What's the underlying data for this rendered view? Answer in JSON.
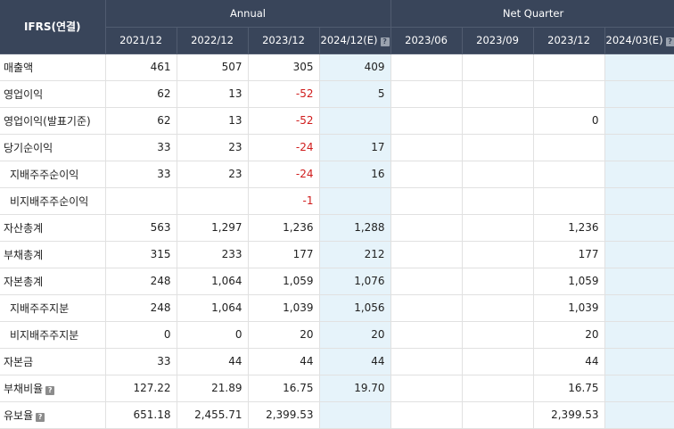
{
  "header": {
    "corner": "IFRS(연결)",
    "annual_label": "Annual",
    "quarter_label": "Net Quarter",
    "help_icon_glyph": "?",
    "annual_periods": [
      "2021/12",
      "2022/12",
      "2023/12",
      "2024/12(E)"
    ],
    "quarter_periods": [
      "2023/06",
      "2023/09",
      "2023/12",
      "2024/03(E)"
    ]
  },
  "rows": [
    {
      "label": "매출액",
      "indent": false,
      "help": false,
      "values": [
        "461",
        "507",
        "305",
        "409",
        "",
        "",
        "",
        ""
      ]
    },
    {
      "label": "영업이익",
      "indent": false,
      "help": false,
      "values": [
        "62",
        "13",
        "-52",
        "5",
        "",
        "",
        "",
        ""
      ]
    },
    {
      "label": "영업이익(발표기준)",
      "indent": false,
      "help": false,
      "values": [
        "62",
        "13",
        "-52",
        "",
        "",
        "",
        "0",
        ""
      ]
    },
    {
      "label": "당기순이익",
      "indent": false,
      "help": false,
      "values": [
        "33",
        "23",
        "-24",
        "17",
        "",
        "",
        "",
        ""
      ]
    },
    {
      "label": "지배주주순이익",
      "indent": true,
      "help": false,
      "values": [
        "33",
        "23",
        "-24",
        "16",
        "",
        "",
        "",
        ""
      ]
    },
    {
      "label": "비지배주주순이익",
      "indent": true,
      "help": false,
      "values": [
        "",
        "",
        "-1",
        "",
        "",
        "",
        "",
        ""
      ]
    },
    {
      "label": "자산총계",
      "indent": false,
      "help": false,
      "values": [
        "563",
        "1,297",
        "1,236",
        "1,288",
        "",
        "",
        "1,236",
        ""
      ]
    },
    {
      "label": "부채총계",
      "indent": false,
      "help": false,
      "values": [
        "315",
        "233",
        "177",
        "212",
        "",
        "",
        "177",
        ""
      ]
    },
    {
      "label": "자본총계",
      "indent": false,
      "help": false,
      "values": [
        "248",
        "1,064",
        "1,059",
        "1,076",
        "",
        "",
        "1,059",
        ""
      ]
    },
    {
      "label": "지배주주지분",
      "indent": true,
      "help": false,
      "values": [
        "248",
        "1,064",
        "1,039",
        "1,056",
        "",
        "",
        "1,039",
        ""
      ]
    },
    {
      "label": "비지배주주지분",
      "indent": true,
      "help": false,
      "values": [
        "0",
        "0",
        "20",
        "20",
        "",
        "",
        "20",
        ""
      ]
    },
    {
      "label": "자본금",
      "indent": false,
      "help": false,
      "values": [
        "33",
        "44",
        "44",
        "44",
        "",
        "",
        "44",
        ""
      ]
    },
    {
      "label": "부채비율",
      "indent": false,
      "help": true,
      "values": [
        "127.22",
        "21.89",
        "16.75",
        "19.70",
        "",
        "",
        "16.75",
        ""
      ]
    },
    {
      "label": "유보율",
      "indent": false,
      "help": true,
      "values": [
        "651.18",
        "2,455.71",
        "2,399.53",
        "",
        "",
        "",
        "2,399.53",
        ""
      ]
    }
  ],
  "colors": {
    "header_bg": "#39455a",
    "estimate_bg": "#e6f3fa",
    "negative": "#d01c1c"
  }
}
